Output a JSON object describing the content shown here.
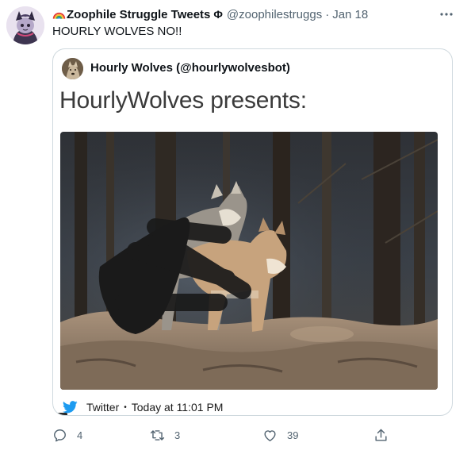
{
  "tweet": {
    "display_name": "Zoophile Struggle Tweets",
    "name_symbol": "Φ",
    "handle": "@zoophilestruggs",
    "separator": "·",
    "date": "Jan 18",
    "text": "HOURLY WOLVES NO!!",
    "more_icon": "more-horizontal-icon"
  },
  "quoted": {
    "name": "Hourly Wolves (@hourlywolvesbot)",
    "headline": "HourlyWolves presents:",
    "source_label": "Twitter",
    "source_separator": "•",
    "timestamp": "Today at 11:01 PM",
    "source_icon": "twitter-bird-icon"
  },
  "actions": {
    "replies": "4",
    "retweets": "3",
    "likes": "39",
    "reply_icon": "reply-icon",
    "retweet_icon": "retweet-icon",
    "like_icon": "heart-icon",
    "share_icon": "share-icon"
  },
  "colors": {
    "secondary_text": "#536471",
    "twitter_blue": "#1d9bf0",
    "border": "#cfd9de"
  }
}
